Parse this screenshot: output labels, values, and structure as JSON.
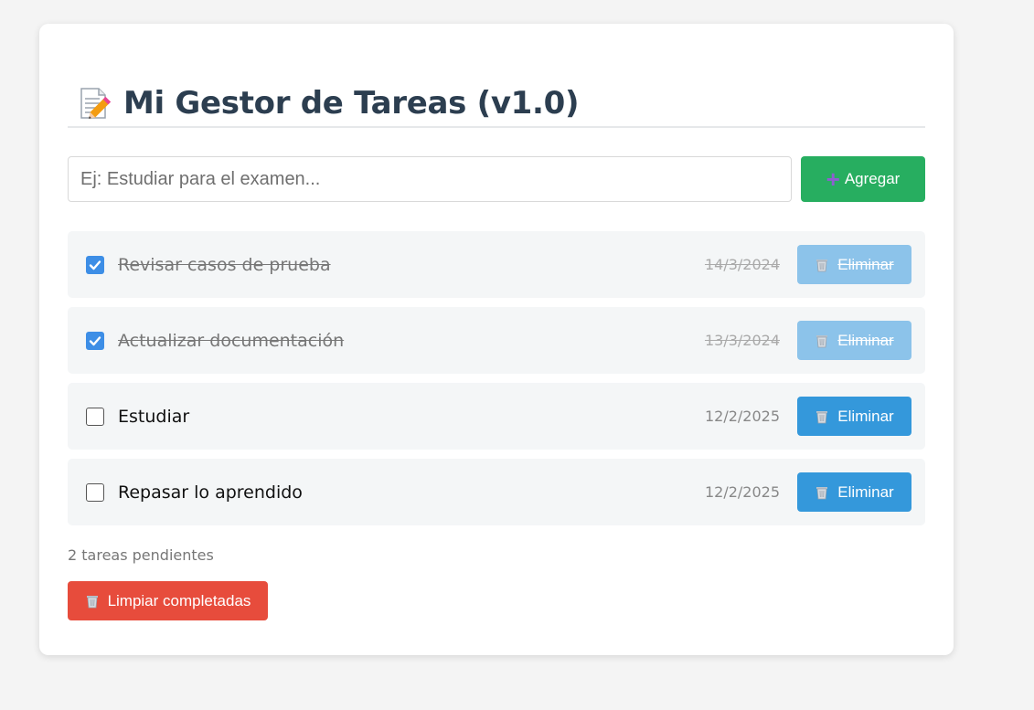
{
  "header": {
    "icon": "memo-icon",
    "title": "Mi Gestor de Tareas (v1.0)"
  },
  "add_form": {
    "placeholder": "Ej: Estudiar para el examen...",
    "value": "",
    "button_icon": "plus-icon",
    "button_label": "Agregar"
  },
  "tasks": [
    {
      "text": "Revisar casos de prueba",
      "date": "14/3/2024",
      "completed": true,
      "delete_label": "Eliminar"
    },
    {
      "text": "Actualizar documentación",
      "date": "13/3/2024",
      "completed": true,
      "delete_label": "Eliminar"
    },
    {
      "text": "Estudiar",
      "date": "12/2/2025",
      "completed": false,
      "delete_label": "Eliminar"
    },
    {
      "text": "Repasar lo aprendido",
      "date": "12/2/2025",
      "completed": false,
      "delete_label": "Eliminar"
    }
  ],
  "footer": {
    "pending_text": "2 tareas pendientes",
    "clear_label": "Limpiar completadas"
  },
  "colors": {
    "background": "#f4f4f4",
    "title": "#2c3e50",
    "add_button": "#27ae60",
    "delete_button": "#3498db",
    "delete_button_done": "#8cc3ea",
    "clear_button": "#e74c3c",
    "checkbox_checked": "#3d8ee6"
  }
}
